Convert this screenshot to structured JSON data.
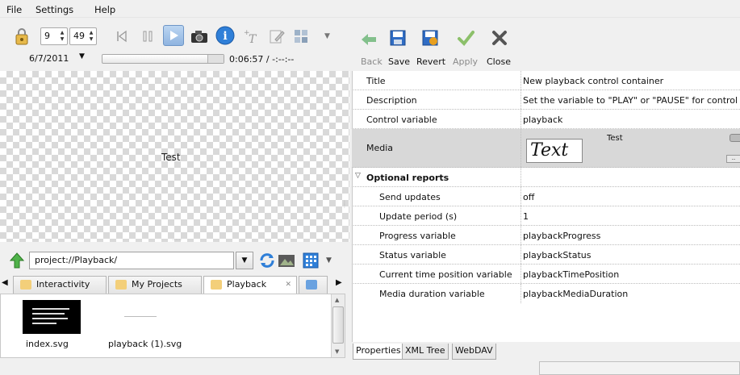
{
  "menu": {
    "items": [
      "File",
      "Settings",
      "Help"
    ]
  },
  "toolbar_left": {
    "hour": "9",
    "minute": "49",
    "date": "6/7/2011",
    "time_readout": "0:06:57 / -:--:--"
  },
  "preview": {
    "text": "Test"
  },
  "file_browser": {
    "path": "project://Playback/",
    "tabs": [
      {
        "label": "Interactivity"
      },
      {
        "label": "My Projects"
      },
      {
        "label": "Playback"
      }
    ],
    "files": [
      {
        "name": "index.svg"
      },
      {
        "name": "playback (1).svg"
      }
    ]
  },
  "toolbar_right": {
    "back": "Back",
    "save": "Save",
    "revert": "Revert",
    "apply": "Apply",
    "close": "Close"
  },
  "properties": {
    "rows": [
      {
        "key": "Title",
        "value": "New playback control container"
      },
      {
        "key": "Description",
        "value": "Set the variable to \"PLAY\" or \"PAUSE\" for control"
      },
      {
        "key": "Control variable",
        "value": "playback"
      },
      {
        "key": "Media",
        "value": ""
      },
      {
        "key": "Optional reports",
        "value": ""
      },
      {
        "key": "Send updates",
        "value": "off"
      },
      {
        "key": "Update period (s)",
        "value": "1"
      },
      {
        "key": "Progress variable",
        "value": "playbackProgress"
      },
      {
        "key": "Status variable",
        "value": "playbackStatus"
      },
      {
        "key": "Current time position variable",
        "value": "playbackTimePosition"
      },
      {
        "key": "Media duration variable",
        "value": "playbackMediaDuration"
      }
    ],
    "media_preview_text": "Text",
    "media_caption": "Test"
  },
  "bottom_tabs": [
    "Properties",
    "XML Tree",
    "WebDAV"
  ],
  "colors": {
    "accent_blue": "#2f7fd8",
    "back_green": "#3aa04a"
  }
}
